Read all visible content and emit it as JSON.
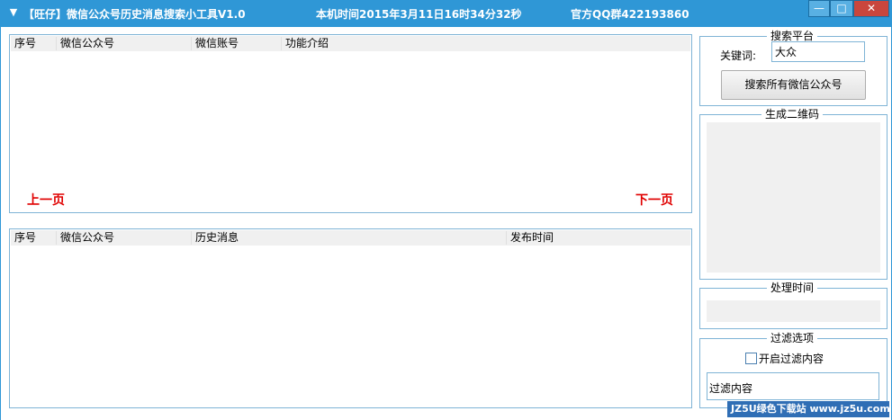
{
  "window": {
    "title": "【旺仔】微信公众号历史消息搜索小工具V1.0",
    "clock": "本机时间2015年3月11日16时34分32秒",
    "qq_group": "官方QQ群422193860",
    "minimize_glyph": "—",
    "maximize_glyph": "□",
    "close_glyph": "✕"
  },
  "account_list": {
    "columns": [
      "序号",
      "微信公众号",
      "微信账号",
      "功能介绍"
    ],
    "rows": [],
    "prev_page": "上一页",
    "next_page": "下一页"
  },
  "message_list": {
    "columns": [
      "序号",
      "微信公众号",
      "历史消息",
      "发布时间"
    ],
    "rows": []
  },
  "search_platform": {
    "title": "搜索平台",
    "keyword_label": "关键词:",
    "keyword_value": "大众",
    "search_button": "搜索所有微信公众号"
  },
  "qr_panel": {
    "title": "生成二维码"
  },
  "process_time": {
    "title": "处理时间",
    "value": ""
  },
  "filter": {
    "title": "过滤选项",
    "enable_label": "开启过滤内容",
    "enabled": false,
    "content_value": "过滤内容"
  },
  "watermark": {
    "text": "JZ5U绿色下载站 www.jz5u.com"
  },
  "colors": {
    "titlebar": "#2f97d6",
    "border": "#7fb4d6",
    "pager": "#e00000"
  }
}
